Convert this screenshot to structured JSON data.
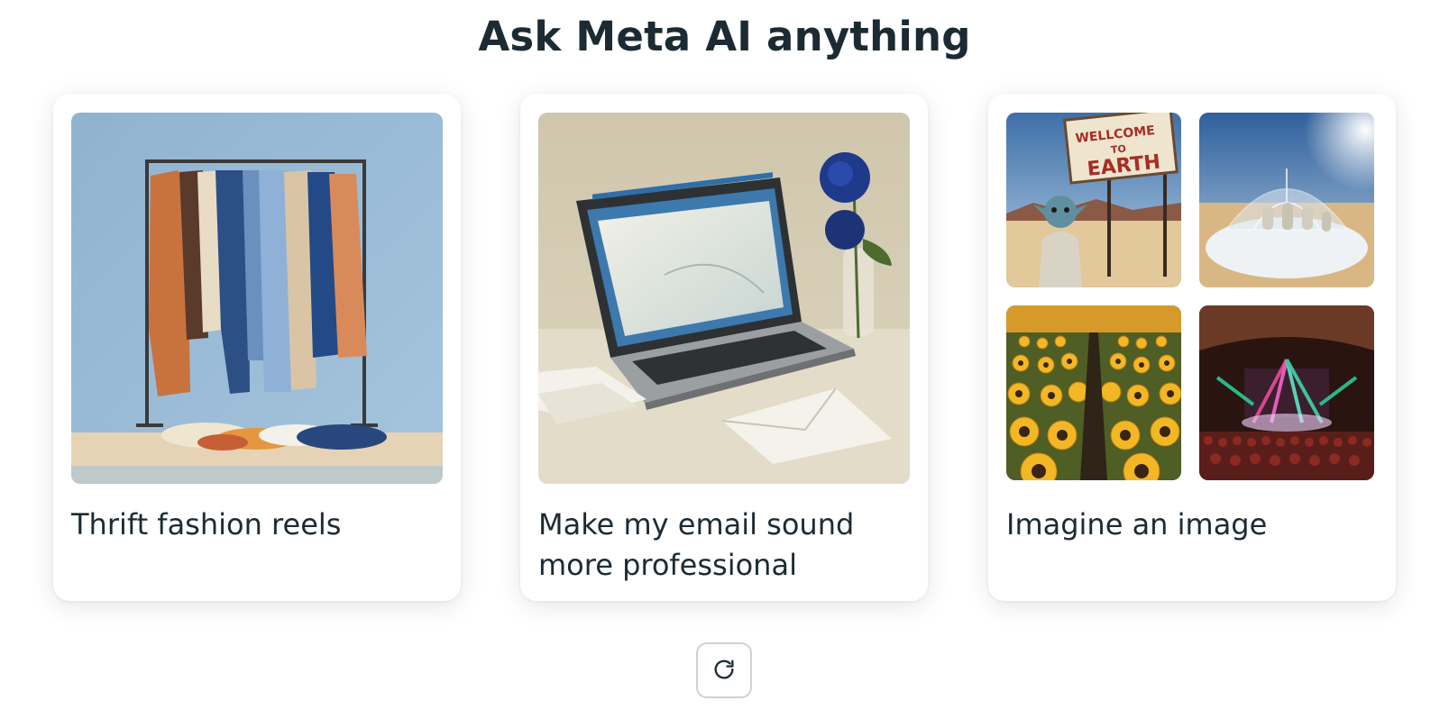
{
  "header": {
    "title": "Ask Meta AI anything"
  },
  "cards": [
    {
      "label": "Thrift fashion reels",
      "image": "clothing-rack-painting"
    },
    {
      "label": "Make my email sound more professional",
      "image": "laptop-envelopes-painting"
    },
    {
      "label": "Imagine an image",
      "images": [
        {
          "name": "alien-welcome-sign",
          "sign_text": [
            "WELLCOME",
            "TO",
            "EARTH"
          ]
        },
        {
          "name": "desert-dome"
        },
        {
          "name": "sunflower-field"
        },
        {
          "name": "concert-stage"
        }
      ]
    }
  ],
  "controls": {
    "refresh_icon": "refresh-icon"
  },
  "colors": {
    "text": "#1c2b33",
    "card_background": "#ffffff",
    "button_border": "#cbd2d9"
  }
}
